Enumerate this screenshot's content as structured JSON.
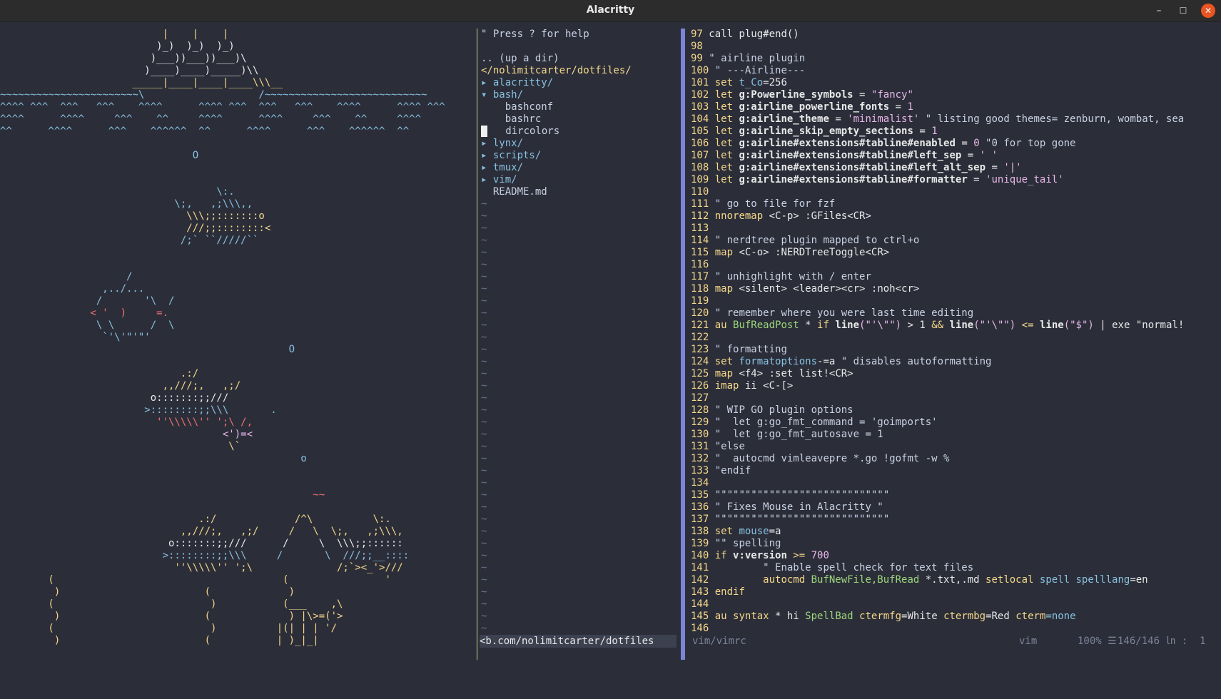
{
  "window": {
    "title": "Alacritty",
    "minimize": "–",
    "maximize": "☐",
    "close": "✕"
  },
  "ascii_art": [
    {
      "t": "                           |    |    |",
      "c": "art-y"
    },
    {
      "t": "                          )_)  )_)  )_)",
      "c": "art-w"
    },
    {
      "t": "                         )___))___))___)\\",
      "c": "art-w"
    },
    {
      "t": "                        )____)____)_____)\\\\",
      "c": "art-w"
    },
    {
      "t": "                      _____|____|____|____\\\\\\__",
      "c": "art-y"
    },
    {
      "t": "~~~~~~~~~~~~~~~~~~~~~~~\\                   /~~~~~~~~~~~~~~~~~~~~~~~~~~~",
      "c": "art-b"
    },
    {
      "t": "^^^^ ^^^  ^^^   ^^^    ^^^^      ^^^^ ^^^  ^^^   ^^^    ^^^^      ^^^^ ^^^",
      "c": "art-b"
    },
    {
      "t": "^^^^      ^^^^     ^^^    ^^     ^^^^      ^^^^     ^^^    ^^     ^^^^",
      "c": "art-b"
    },
    {
      "t": "^^      ^^^^      ^^^    ^^^^^^  ^^      ^^^^      ^^^    ^^^^^^  ^^",
      "c": "art-b"
    },
    {
      "t": "",
      "c": "art-w"
    },
    {
      "t": "                                O",
      "c": "art-b"
    },
    {
      "t": "",
      "c": "art-w"
    },
    {
      "t": "",
      "c": "art-w"
    },
    {
      "t": "                                    \\:.",
      "c": "art-b"
    },
    {
      "t": "                             \\;,   ,;\\\\\\,,",
      "c": "art-b"
    },
    {
      "t": "                               \\\\\\;;:::::::o",
      "c": "art-y"
    },
    {
      "t": "                               ///;;::::::::<",
      "c": "art-y"
    },
    {
      "t": "                              /;` ``/////``",
      "c": "art-b"
    },
    {
      "t": "",
      "c": "art-w"
    },
    {
      "t": "",
      "c": "art-w"
    },
    {
      "t": "                     /",
      "c": "art-b"
    },
    {
      "t": "                 ,../...",
      "c": "art-b"
    },
    {
      "t": "                /       '\\  /",
      "c": "art-b"
    },
    {
      "t": "               < '  )     =.",
      "c": "art-r"
    },
    {
      "t": "                \\ \\      /  \\",
      "c": "art-b"
    },
    {
      "t": "                 `'\\'\"'\"'",
      "c": "art-b"
    },
    {
      "t": "                                                O",
      "c": "art-b"
    },
    {
      "t": "",
      "c": "art-w"
    },
    {
      "t": "                              .:/",
      "c": "art-y"
    },
    {
      "t": "                           ,,///;,   ,;/",
      "c": "art-y"
    },
    {
      "t": "                         o:::::::;;///",
      "c": "art-w"
    },
    {
      "t": "                        >::::::::;;\\\\\\       .",
      "c": "art-b"
    },
    {
      "t": "                          ''\\\\\\\\\\'' ';\\ /,",
      "c": "art-r"
    },
    {
      "t": "                                     <')=<",
      "c": "art-p"
    },
    {
      "t": "                                      \\`",
      "c": "art-y"
    },
    {
      "t": "                                                  o",
      "c": "art-b"
    },
    {
      "t": "",
      "c": "art-w"
    },
    {
      "t": "",
      "c": "art-w"
    },
    {
      "t": "                                                    ~~",
      "c": "art-r"
    },
    {
      "t": "",
      "c": "art-w"
    },
    {
      "t": "                                 .:/             /^\\          \\:.",
      "c": "art-y"
    },
    {
      "t": "                              ,,///;,   ,;/     /   \\  \\;,   ,;\\\\\\,",
      "c": "art-y"
    },
    {
      "t": "                            o:::::::;;///      /     \\  \\\\\\;;::::::",
      "c": "art-w"
    },
    {
      "t": "                           >::::::::;;\\\\\\     /       \\  ///;;__::::",
      "c": "art-b"
    },
    {
      "t": "                             ''\\\\\\\\\\'' ';\\              /;`><_'>///",
      "c": "art-y"
    },
    {
      "t": "        (                                      (                '",
      "c": "art-y"
    },
    {
      "t": "         )                        (             )",
      "c": "art-y"
    },
    {
      "t": "        (                          )           (___    ,\\",
      "c": "art-y"
    },
    {
      "t": "         )                        (             ) |\\>=('>",
      "c": "art-y"
    },
    {
      "t": "        (                          )          |(| | | '/",
      "c": "art-y"
    },
    {
      "t": "         )                        (           | )_|_|",
      "c": "art-y"
    }
  ],
  "tree": {
    "help": "\" Press ? for help",
    "up": ".. (up a dir)",
    "root": "</nolimitcarter/dotfiles/",
    "entries": [
      {
        "text": "▸ alacritty/",
        "cls": "tree-dir"
      },
      {
        "text": "▾ bash/",
        "cls": "tree-dir"
      },
      {
        "text": "    bashconf",
        "cls": "tree-file"
      },
      {
        "text": "    bashrc",
        "cls": "tree-file"
      },
      {
        "text": "    dircolors",
        "cls": "tree-file",
        "cursor": true
      },
      {
        "text": "▸ lynx/",
        "cls": "tree-dir"
      },
      {
        "text": "▸ scripts/",
        "cls": "tree-dir"
      },
      {
        "text": "▸ tmux/",
        "cls": "tree-dir"
      },
      {
        "text": "▸ vim/",
        "cls": "tree-dir"
      },
      {
        "text": "  README.md",
        "cls": "tree-file"
      }
    ],
    "tilde_count": 36,
    "status": "<b.com/nolimitcarter/dotfiles"
  },
  "editor": {
    "lines": [
      [
        [
          "97 ",
          "gutter"
        ],
        [
          "call plug#end()",
          "plain"
        ]
      ],
      [
        [
          "98 ",
          "gutter"
        ]
      ],
      [
        [
          "99 ",
          "gutter"
        ],
        [
          "\" airline plugin",
          "cmt"
        ]
      ],
      [
        [
          "100",
          "gutter"
        ],
        [
          " \" ---Airline---",
          "cmt"
        ]
      ],
      [
        [
          "101",
          "gutter"
        ],
        [
          " set ",
          "kw"
        ],
        [
          "t_Co",
          "opt"
        ],
        [
          "=256",
          "plain"
        ]
      ],
      [
        [
          "102",
          "gutter"
        ],
        [
          " let ",
          "kw"
        ],
        [
          "g:Powerline_symbols",
          "var"
        ],
        [
          " = ",
          "plain"
        ],
        [
          "\"fancy\"",
          "str"
        ]
      ],
      [
        [
          "103",
          "gutter"
        ],
        [
          " let ",
          "kw"
        ],
        [
          "g:airline_powerline_fonts",
          "var"
        ],
        [
          " = ",
          "plain"
        ],
        [
          "1",
          "num"
        ]
      ],
      [
        [
          "104",
          "gutter"
        ],
        [
          " let ",
          "kw"
        ],
        [
          "g:airline_theme",
          "var"
        ],
        [
          " = ",
          "plain"
        ],
        [
          "'minimalist'",
          "str"
        ],
        [
          " \" listing good themes= zenburn, wombat, sea",
          "cmt"
        ]
      ],
      [
        [
          "105",
          "gutter"
        ],
        [
          " let ",
          "kw"
        ],
        [
          "g:airline_skip_empty_sections",
          "var"
        ],
        [
          " = ",
          "plain"
        ],
        [
          "1",
          "num"
        ]
      ],
      [
        [
          "106",
          "gutter"
        ],
        [
          " let ",
          "kw"
        ],
        [
          "g:airline#extensions#tabline#enabled",
          "var"
        ],
        [
          " = ",
          "plain"
        ],
        [
          "0",
          "num"
        ],
        [
          " \"0 for top gone",
          "cmt"
        ]
      ],
      [
        [
          "107",
          "gutter"
        ],
        [
          " let ",
          "kw"
        ],
        [
          "g:airline#extensions#tabline#left_sep",
          "var"
        ],
        [
          " = ",
          "plain"
        ],
        [
          "' '",
          "str"
        ]
      ],
      [
        [
          "108",
          "gutter"
        ],
        [
          " let ",
          "kw"
        ],
        [
          "g:airline#extensions#tabline#left_alt_sep",
          "var"
        ],
        [
          " = ",
          "plain"
        ],
        [
          "'|'",
          "str"
        ]
      ],
      [
        [
          "109",
          "gutter"
        ],
        [
          " let ",
          "kw"
        ],
        [
          "g:airline#extensions#tabline#formatter",
          "var"
        ],
        [
          " = ",
          "plain"
        ],
        [
          "'unique_tail'",
          "str"
        ]
      ],
      [
        [
          "110",
          "gutter"
        ]
      ],
      [
        [
          "111",
          "gutter"
        ],
        [
          " \" go to file for fzf",
          "cmt"
        ]
      ],
      [
        [
          "112",
          "gutter"
        ],
        [
          " nnoremap ",
          "kw"
        ],
        [
          "<C-p>",
          "plain"
        ],
        [
          " :GFiles",
          "plain"
        ],
        [
          "<CR>",
          "plain"
        ]
      ],
      [
        [
          "113",
          "gutter"
        ]
      ],
      [
        [
          "114",
          "gutter"
        ],
        [
          " \" nerdtree plugin mapped to ctrl+o",
          "cmt"
        ]
      ],
      [
        [
          "115",
          "gutter"
        ],
        [
          " map ",
          "kw"
        ],
        [
          "<C-o>",
          "plain"
        ],
        [
          " :NERDTreeToggle",
          "plain"
        ],
        [
          "<CR>",
          "plain"
        ]
      ],
      [
        [
          "116",
          "gutter"
        ]
      ],
      [
        [
          "117",
          "gutter"
        ],
        [
          " \" unhighlight with / enter",
          "cmt"
        ]
      ],
      [
        [
          "118",
          "gutter"
        ],
        [
          " map ",
          "kw"
        ],
        [
          "<silent> <leader><cr>",
          "plain"
        ],
        [
          " :noh",
          "plain"
        ],
        [
          "<cr>",
          "plain"
        ]
      ],
      [
        [
          "119",
          "gutter"
        ]
      ],
      [
        [
          "120",
          "gutter"
        ],
        [
          " \" remember where you were last time editing",
          "cmt"
        ]
      ],
      [
        [
          "121",
          "gutter"
        ],
        [
          " au ",
          "kw"
        ],
        [
          "BufReadPost",
          "fn"
        ],
        [
          " * ",
          "plain"
        ],
        [
          "if ",
          "kw"
        ],
        [
          "line",
          "var"
        ],
        [
          "(\"'\\\"\")",
          "str"
        ],
        [
          " > 1 ",
          "plain"
        ],
        [
          "&& ",
          "kw"
        ],
        [
          "line",
          "var"
        ],
        [
          "(\"'\\\"\")",
          "str"
        ],
        [
          " <= ",
          "kw"
        ],
        [
          "line",
          "var"
        ],
        [
          "(\"$\")",
          "str"
        ],
        [
          " | exe \"normal!",
          "plain"
        ]
      ],
      [
        [
          "122",
          "gutter"
        ]
      ],
      [
        [
          "123",
          "gutter"
        ],
        [
          " \" formatting",
          "cmt"
        ]
      ],
      [
        [
          "124",
          "gutter"
        ],
        [
          " set ",
          "kw"
        ],
        [
          "formatoptions",
          "opt"
        ],
        [
          "-=a",
          "plain"
        ],
        [
          " \" disables autoformatting",
          "cmt"
        ]
      ],
      [
        [
          "125",
          "gutter"
        ],
        [
          " map ",
          "kw"
        ],
        [
          "<f4>",
          "plain"
        ],
        [
          " :set list!",
          "plain"
        ],
        [
          "<CR>",
          "plain"
        ]
      ],
      [
        [
          "126",
          "gutter"
        ],
        [
          " imap ",
          "kw"
        ],
        [
          "ii ",
          "plain"
        ],
        [
          "<C-[>",
          "plain"
        ]
      ],
      [
        [
          "127",
          "gutter"
        ]
      ],
      [
        [
          "128",
          "gutter"
        ],
        [
          " \" WIP GO plugin options",
          "cmt"
        ]
      ],
      [
        [
          "129",
          "gutter"
        ],
        [
          " \"  let g:go_fmt_command = 'goimports'",
          "cmt"
        ]
      ],
      [
        [
          "130",
          "gutter"
        ],
        [
          " \"  let g:go_fmt_autosave = 1",
          "cmt"
        ]
      ],
      [
        [
          "131",
          "gutter"
        ],
        [
          " \"else",
          "cmt"
        ]
      ],
      [
        [
          "132",
          "gutter"
        ],
        [
          " \"  autocmd vimleavepre *.go !gofmt -w %",
          "cmt"
        ]
      ],
      [
        [
          "133",
          "gutter"
        ],
        [
          " \"endif",
          "cmt"
        ]
      ],
      [
        [
          "134",
          "gutter"
        ]
      ],
      [
        [
          "135",
          "gutter"
        ],
        [
          " \"\"\"\"\"\"\"\"\"\"\"\"\"\"\"\"\"\"\"\"\"\"\"\"\"\"\"\"\"",
          "cmt"
        ]
      ],
      [
        [
          "136",
          "gutter"
        ],
        [
          " \" Fixes Mouse in Alacritty \"",
          "cmt"
        ]
      ],
      [
        [
          "137",
          "gutter"
        ],
        [
          " \"\"\"\"\"\"\"\"\"\"\"\"\"\"\"\"\"\"\"\"\"\"\"\"\"\"\"\"\"",
          "cmt"
        ]
      ],
      [
        [
          "138",
          "gutter"
        ],
        [
          " set ",
          "kw"
        ],
        [
          "mouse",
          "opt"
        ],
        [
          "=a",
          "plain"
        ]
      ],
      [
        [
          "139",
          "gutter"
        ],
        [
          " \"\" spelling",
          "cmt"
        ]
      ],
      [
        [
          "140",
          "gutter"
        ],
        [
          " if ",
          "kw"
        ],
        [
          "v:version",
          "var"
        ],
        [
          " >= ",
          "kw"
        ],
        [
          "700",
          "num"
        ]
      ],
      [
        [
          "141",
          "gutter"
        ],
        [
          "         \" Enable spell check for text files",
          "cmt"
        ]
      ],
      [
        [
          "142",
          "gutter"
        ],
        [
          "         autocmd ",
          "kw"
        ],
        [
          "BufNewFile,BufRead",
          "fn"
        ],
        [
          " *.txt,.md ",
          "plain"
        ],
        [
          "setlocal ",
          "kw"
        ],
        [
          "spell ",
          "opt"
        ],
        [
          "spelllang",
          "opt"
        ],
        [
          "=en",
          "plain"
        ]
      ],
      [
        [
          "143",
          "gutter"
        ],
        [
          " endif",
          "kw"
        ]
      ],
      [
        [
          "144",
          "gutter"
        ]
      ],
      [
        [
          "145",
          "gutter"
        ],
        [
          " au ",
          "kw"
        ],
        [
          "syntax",
          "kw"
        ],
        [
          " * hi ",
          "plain"
        ],
        [
          "SpellBad ",
          "fn"
        ],
        [
          "ctermfg",
          "kw"
        ],
        [
          "=White ",
          "plain"
        ],
        [
          "ctermbg",
          "kw"
        ],
        [
          "=Red ",
          "plain"
        ],
        [
          "cterm",
          "kw"
        ],
        [
          "=none",
          "opt"
        ]
      ],
      [
        [
          "146",
          "gutter"
        ]
      ]
    ],
    "status": {
      "file": "vim/vimrc",
      "filetype": "vim",
      "percent": "100% ☰",
      "position": "146/146 ㏑ :  1"
    }
  },
  "colors": {
    "background": "#2b2e39",
    "separator_green": "#c5d67a",
    "separator_blue": "#7b85d8",
    "close_button": "#e95420"
  }
}
